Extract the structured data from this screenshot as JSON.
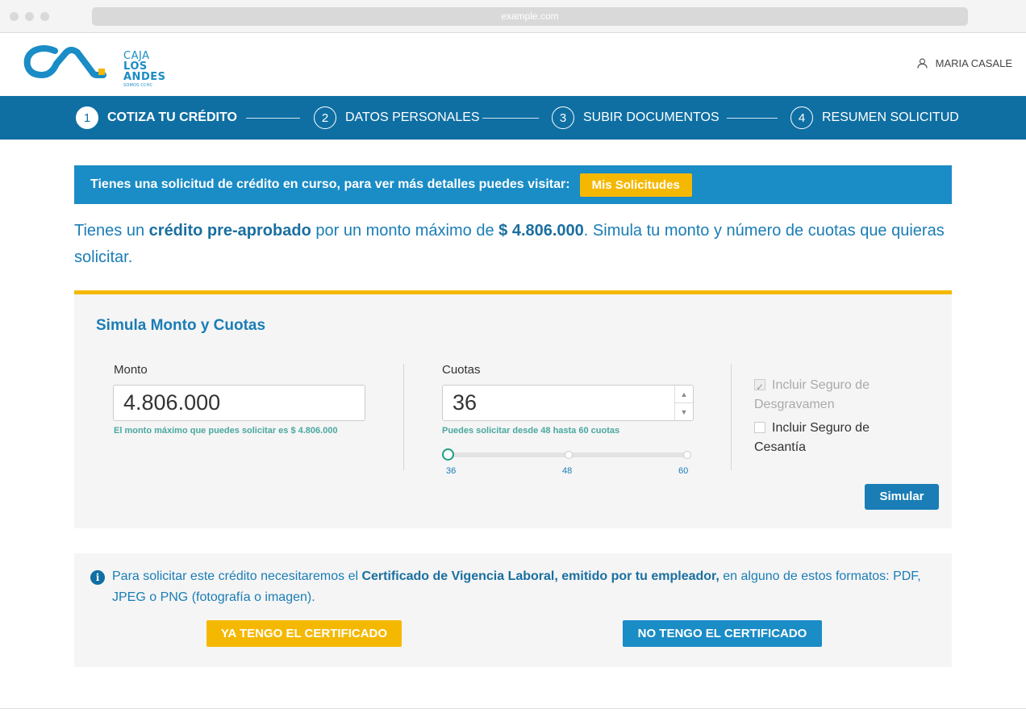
{
  "browser": {
    "url": "example.com"
  },
  "header": {
    "logo": {
      "line1": "CAJA",
      "line2": "LOS",
      "line3": "ANDES",
      "line4": "SOMOS CCHC"
    },
    "user_name": "MARIA CASALE"
  },
  "stepper": [
    {
      "num": "1",
      "label": "COTIZA TU CRÉDITO",
      "active": true
    },
    {
      "num": "2",
      "label": "DATOS PERSONALES",
      "active": false
    },
    {
      "num": "3",
      "label": "SUBIR DOCUMENTOS",
      "active": false
    },
    {
      "num": "4",
      "label": "RESUMEN SOLICITUD",
      "active": false
    }
  ],
  "banner": {
    "text": "Tienes una solicitud de crédito en curso, para ver más detalles puedes visitar:",
    "button": "Mis Solicitudes"
  },
  "intro": {
    "p1": "Tienes un ",
    "b1": "crédito pre-aprobado",
    "p2": " por un monto máximo de ",
    "b2": "$ 4.806.000",
    "p3": ". Simula tu monto y número de cuotas que quieras solicitar."
  },
  "simulation": {
    "title": "Simula Monto y Cuotas",
    "monto": {
      "label": "Monto",
      "value": "4.806.000",
      "hint": "El monto máximo que puedes solicitar es $ 4.806.000"
    },
    "cuotas": {
      "label": "Cuotas",
      "value": "36",
      "hint": "Puedes solicitar desde 48 hasta 60 cuotas",
      "slider": {
        "min": 36,
        "max": 60,
        "value": 36,
        "ticks": [
          "36",
          "48",
          "60"
        ]
      }
    },
    "seguro_desgravamen": {
      "label": "Incluir Seguro de Desgravamen",
      "checked": true,
      "disabled": true
    },
    "seguro_cesantia": {
      "label": "Incluir Seguro de Cesantía",
      "checked": false,
      "disabled": false
    },
    "simular_button": "Simular"
  },
  "info": {
    "icon": "info-icon",
    "p1": "Para solicitar este crédito necesitaremos el ",
    "b1": "Certificado de Vigencia Laboral, emitido por tu empleador,",
    "p2": " en alguno de estos formatos: PDF, JPEG o PNG (fotografía o imagen).",
    "btn_yes": "YA TENGO EL CERTIFICADO",
    "btn_no": "NO TENGO EL CERTIFICADO"
  },
  "colors": {
    "primary": "#1a8cc6",
    "dark_primary": "#0f6fa3",
    "accent": "#f5b800",
    "hint_green": "#49a8a0"
  }
}
